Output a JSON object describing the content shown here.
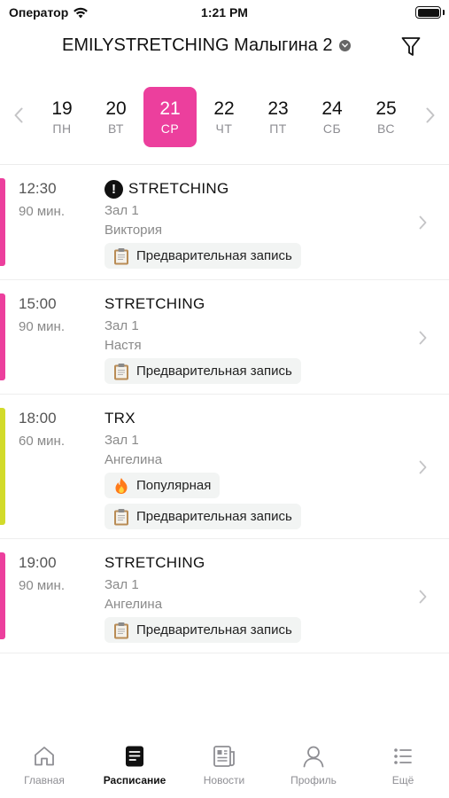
{
  "status_bar": {
    "carrier": "Оператор",
    "time": "1:21 PM"
  },
  "header": {
    "studio": "EMILYSTRETCHING Малыгина 2"
  },
  "week": {
    "days": [
      {
        "num": "19",
        "name": "ПН"
      },
      {
        "num": "20",
        "name": "ВТ"
      },
      {
        "num": "21",
        "name": "СР"
      },
      {
        "num": "22",
        "name": "ЧТ"
      },
      {
        "num": "23",
        "name": "ПТ"
      },
      {
        "num": "24",
        "name": "СБ"
      },
      {
        "num": "25",
        "name": "ВС"
      }
    ],
    "selected_index": 2,
    "selected_color": "#ec3f9d"
  },
  "lessons": [
    {
      "time": "12:30",
      "duration": "90 мин.",
      "title": "STRETCHING",
      "room": "Зал 1",
      "coach": "Виктория",
      "color": "#ec3f9d",
      "alert": true,
      "tags": [
        {
          "icon": "clipboard-icon",
          "label": "Предварительная запись"
        }
      ]
    },
    {
      "time": "15:00",
      "duration": "90 мин.",
      "title": "STRETCHING",
      "room": "Зал 1",
      "coach": "Настя",
      "color": "#ec3f9d",
      "alert": false,
      "tags": [
        {
          "icon": "clipboard-icon",
          "label": "Предварительная запись"
        }
      ]
    },
    {
      "time": "18:00",
      "duration": "60 мин.",
      "title": "TRX",
      "room": "Зал 1",
      "coach": "Ангелина",
      "color": "#d2db2a",
      "alert": false,
      "tags": [
        {
          "icon": "fire-icon",
          "label": "Популярная"
        },
        {
          "icon": "clipboard-icon",
          "label": "Предварительная запись"
        }
      ]
    },
    {
      "time": "19:00",
      "duration": "90 мин.",
      "title": "STRETCHING",
      "room": "Зал 1",
      "coach": "Ангелина",
      "color": "#ec3f9d",
      "alert": false,
      "tags": [
        {
          "icon": "clipboard-icon",
          "label": "Предварительная запись"
        }
      ]
    }
  ],
  "tab_bar": {
    "tabs": [
      {
        "label": "Главная",
        "icon": "home-icon"
      },
      {
        "label": "Расписание",
        "icon": "schedule-icon"
      },
      {
        "label": "Новости",
        "icon": "news-icon"
      },
      {
        "label": "Профиль",
        "icon": "profile-icon"
      },
      {
        "label": "Ещё",
        "icon": "more-icon"
      }
    ],
    "active_index": 1
  }
}
